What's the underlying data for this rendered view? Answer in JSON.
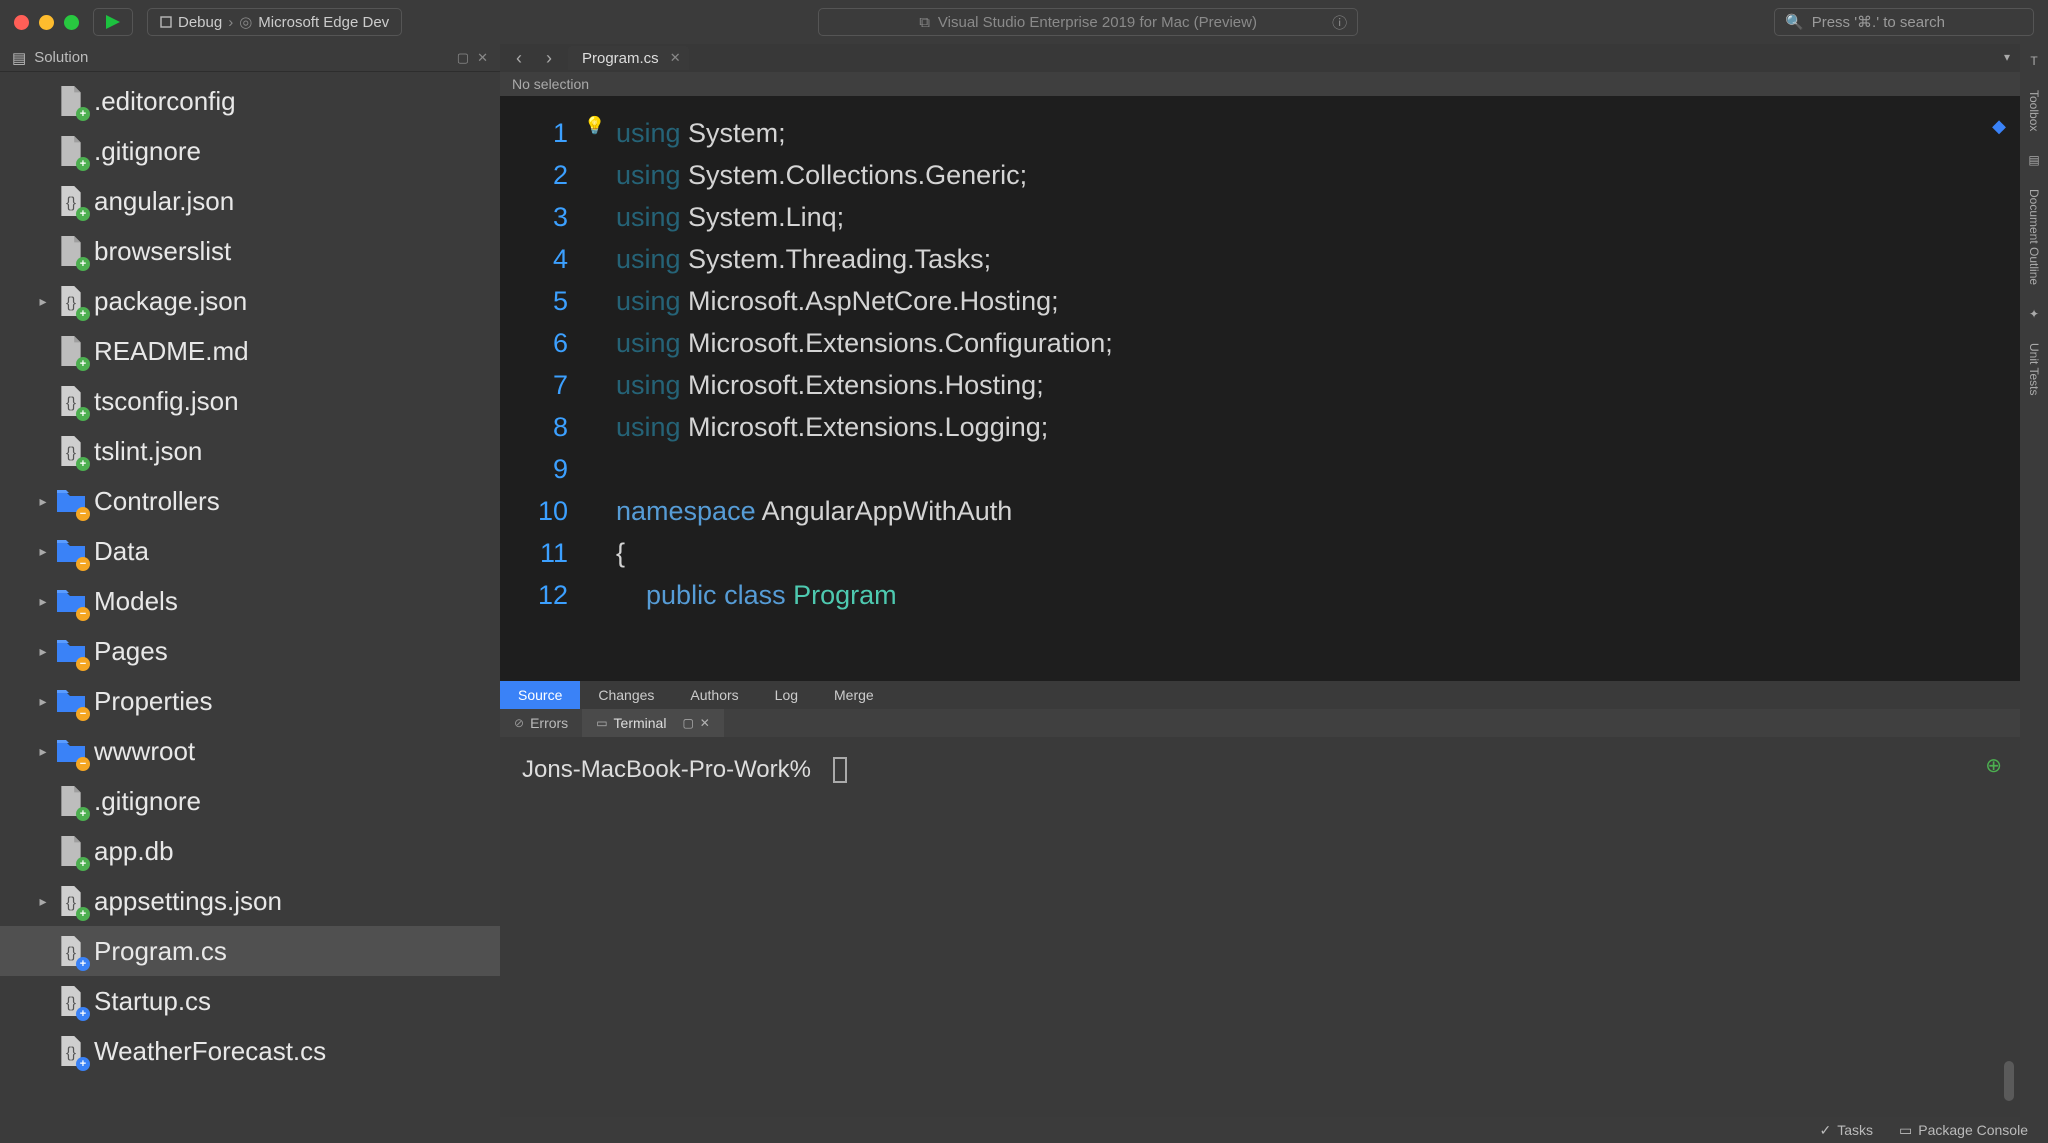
{
  "titlebar": {
    "run_config": "Debug",
    "run_target": "Microsoft Edge Dev",
    "app_title": "Visual Studio Enterprise 2019 for Mac (Preview)",
    "search_placeholder": "Press '⌘.' to search"
  },
  "sidebar": {
    "title": "Solution",
    "items": [
      {
        "name": ".editorconfig",
        "icon": "file",
        "badge": "+"
      },
      {
        "name": ".gitignore",
        "icon": "file",
        "badge": "+"
      },
      {
        "name": "angular.json",
        "icon": "json",
        "badge": "+"
      },
      {
        "name": "browserslist",
        "icon": "file",
        "badge": "+"
      },
      {
        "name": "package.json",
        "icon": "json",
        "badge": "+",
        "expand": true
      },
      {
        "name": "README.md",
        "icon": "file",
        "badge": "+"
      },
      {
        "name": "tsconfig.json",
        "icon": "json",
        "badge": "+"
      },
      {
        "name": "tslint.json",
        "icon": "json",
        "badge": "+"
      },
      {
        "name": "Controllers",
        "icon": "folder",
        "badge": "-",
        "expand": true
      },
      {
        "name": "Data",
        "icon": "folder",
        "badge": "-",
        "expand": true
      },
      {
        "name": "Models",
        "icon": "folder",
        "badge": "-",
        "expand": true
      },
      {
        "name": "Pages",
        "icon": "folder",
        "badge": "-",
        "expand": true
      },
      {
        "name": "Properties",
        "icon": "folder",
        "badge": "-",
        "expand": true
      },
      {
        "name": "wwwroot",
        "icon": "folder",
        "badge": "-",
        "expand": true
      },
      {
        "name": ".gitignore",
        "icon": "file",
        "badge": "+"
      },
      {
        "name": "app.db",
        "icon": "file",
        "badge": "+"
      },
      {
        "name": "appsettings.json",
        "icon": "json",
        "badge": "+",
        "expand": true
      },
      {
        "name": "Program.cs",
        "icon": "json",
        "badge": "b",
        "selected": true
      },
      {
        "name": "Startup.cs",
        "icon": "json",
        "badge": "b"
      },
      {
        "name": "WeatherForecast.cs",
        "icon": "json",
        "badge": "b"
      }
    ]
  },
  "editor": {
    "tab": "Program.cs",
    "breadcrumb": "No selection",
    "lines": [
      "1",
      "2",
      "3",
      "4",
      "5",
      "6",
      "7",
      "8",
      "9",
      "10",
      "11",
      "12"
    ],
    "code": {
      "l1a": "using",
      "l1b": " System;",
      "l2a": "using",
      "l2b": " System.Collections.Generic;",
      "l3a": "using",
      "l3b": " System.Linq;",
      "l4a": "using",
      "l4b": " System.Threading.Tasks;",
      "l5a": "using",
      "l5b": " Microsoft.AspNetCore.Hosting;",
      "l6a": "using",
      "l6b": " Microsoft.Extensions.Configuration;",
      "l7a": "using",
      "l7b": " Microsoft.Extensions.Hosting;",
      "l8a": "using",
      "l8b": " Microsoft.Extensions.Logging;",
      "l10a": "namespace",
      "l10b": " AngularAppWithAuth",
      "l11": "{",
      "l12a": "public",
      "l12b": " class",
      "l12c": " Program"
    }
  },
  "lowtabs": [
    "Source",
    "Changes",
    "Authors",
    "Log",
    "Merge"
  ],
  "panels": {
    "errors": "Errors",
    "terminal": "Terminal"
  },
  "terminal": {
    "prompt": "Jons-MacBook-Pro-Work%"
  },
  "rail": {
    "toolbox": "Toolbox",
    "outline": "Document Outline",
    "tests": "Unit Tests"
  },
  "status": {
    "tasks": "Tasks",
    "console": "Package Console"
  }
}
